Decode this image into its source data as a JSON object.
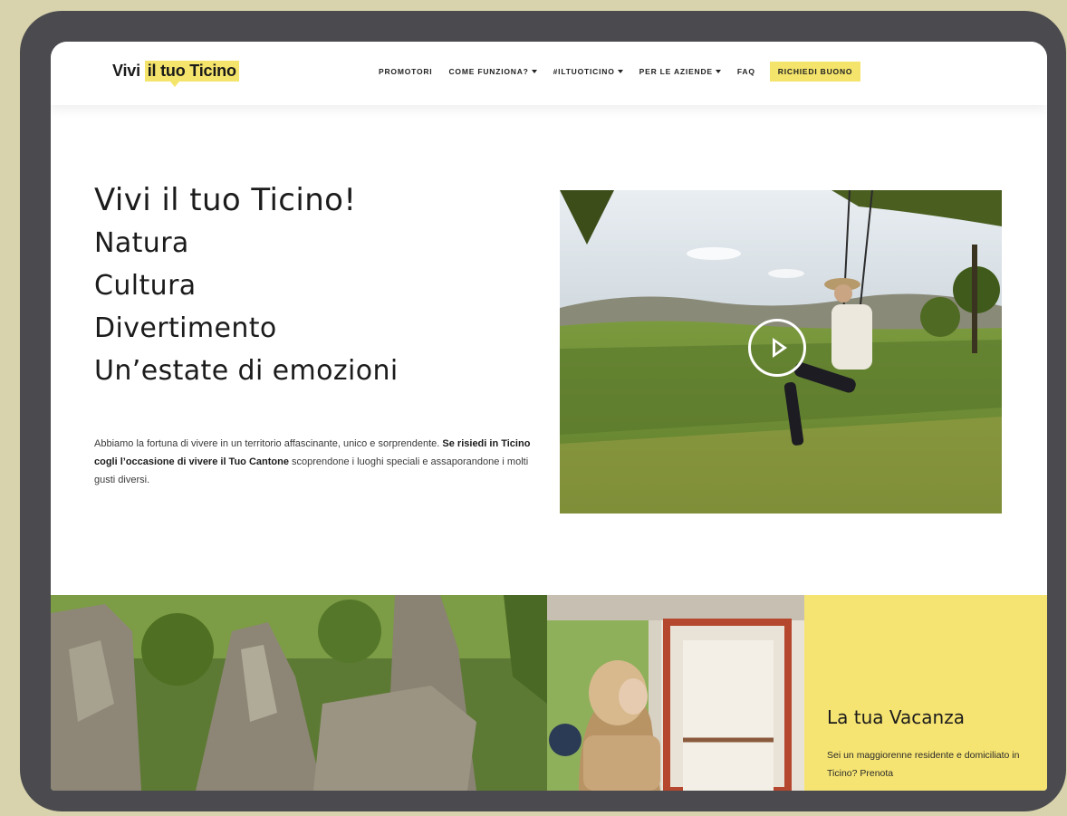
{
  "logo": {
    "prefix": "Vivi ",
    "highlight": "il tuo Ticino"
  },
  "nav": {
    "items": [
      {
        "label": "PROMOTORI",
        "dropdown": false
      },
      {
        "label": "COME FUNZIONA?",
        "dropdown": true
      },
      {
        "label": "#ILTUOTICINO",
        "dropdown": true
      },
      {
        "label": "PER LE AZIENDE",
        "dropdown": true
      },
      {
        "label": "FAQ",
        "dropdown": false
      }
    ],
    "cta": "RICHIEDI BUONO"
  },
  "hero": {
    "lines": [
      "Vivi il tuo Ticino!",
      "Natura",
      "Cultura",
      "Divertimento",
      "Un’estate di emozioni"
    ],
    "text_part1": "Abbiamo la fortuna di vivere in un territorio affascinante, unico e sorprendente. ",
    "text_bold1": "Se risiedi in Ticino cogli l’occasione di vivere il Tuo Cantone",
    "text_part2": " scoprendone i luoghi speciali e assaporandone i molti gusti diversi."
  },
  "promo": {
    "title": "La tua Vacanza",
    "text": "Sei un maggiorenne residente e domiciliato in Ticino? Prenota"
  },
  "colors": {
    "accent_yellow": "#f4e46b",
    "promo_yellow": "#f6e472",
    "device_frame": "#4b4b4f",
    "background": "#d8d3ac"
  }
}
